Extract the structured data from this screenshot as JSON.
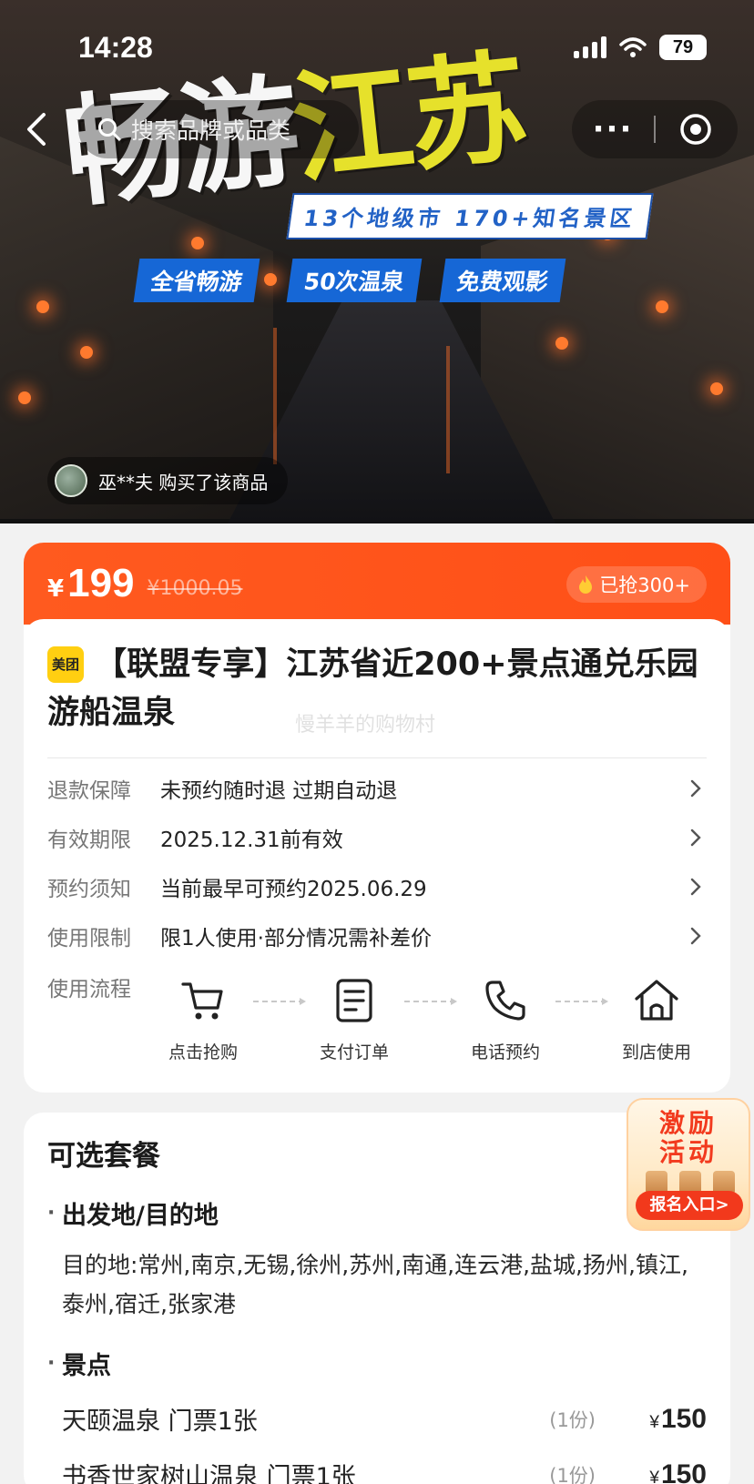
{
  "status_bar": {
    "time": "14:28",
    "battery": "79"
  },
  "header": {
    "search_placeholder": "搜索品牌或品类",
    "more_label": "···"
  },
  "banner": {
    "title_part1": "畅游",
    "title_part2": "江苏",
    "subtitle": "13个地级市 170+知名景区",
    "tags": [
      "全省畅游",
      "50次温泉",
      "免费观影"
    ],
    "buyer_notice": "巫**夫 购买了该商品"
  },
  "price": {
    "currency": "¥",
    "current": "199",
    "original": "¥1000.05",
    "grabbed": "已抢300+"
  },
  "product": {
    "brand_badge": "美团",
    "title": "【联盟专享】江苏省近200+景点通兑乐园游船温泉",
    "watermark": "慢羊羊的购物村"
  },
  "info_rows": [
    {
      "key": "退款保障",
      "value": "未预约随时退 过期自动退"
    },
    {
      "key": "有效期限",
      "value": "2025.12.31前有效"
    },
    {
      "key": "预约须知",
      "value": "当前最早可预约2025.06.29"
    },
    {
      "key": "使用限制",
      "value": "限1人使用·部分情况需补差价"
    }
  ],
  "usage_flow": {
    "label": "使用流程",
    "steps": [
      "点击抢购",
      "支付订单",
      "电话预约",
      "到店使用"
    ]
  },
  "packages": {
    "title": "可选套餐",
    "origin_dest_heading": "出发地/目的地",
    "destinations": "目的地:常州,南京,无锡,徐州,苏州,南通,连云港,盐城,扬州,镇江,泰州,宿迁,张家港",
    "attractions_heading": "景点",
    "items": [
      {
        "name": "天颐温泉 门票1张",
        "qty": "(1份)",
        "currency": "¥",
        "price": "150"
      },
      {
        "name": "书香世家树山温泉 门票1张",
        "qty": "(1份)",
        "currency": "¥",
        "price": "150"
      }
    ]
  },
  "promo": {
    "title_line1": "激励",
    "title_line2": "活动",
    "button": "报名入口>"
  },
  "colors": {
    "accent": "#ff5a1f",
    "banner_blue": "#1667d6",
    "title_yellow": "#e6e12b",
    "brand_yellow": "#ffcf11"
  }
}
